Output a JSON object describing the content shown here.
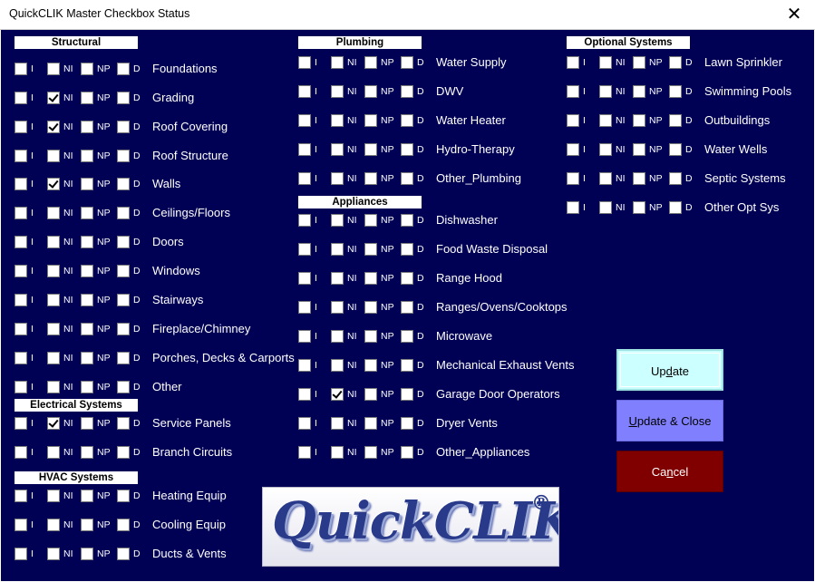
{
  "window": {
    "title": "QuickCLIK Master Checkbox Status",
    "close_glyph": "✕"
  },
  "checkbox_labels": [
    "I",
    "NI",
    "NP",
    "D"
  ],
  "sections": {
    "structural": {
      "header": "Structural",
      "items": [
        {
          "label": "Foundations",
          "checked": [
            false,
            false,
            false,
            false
          ]
        },
        {
          "label": "Grading",
          "checked": [
            false,
            true,
            false,
            false
          ]
        },
        {
          "label": "Roof Covering",
          "checked": [
            false,
            true,
            false,
            false
          ]
        },
        {
          "label": "Roof Structure",
          "checked": [
            false,
            false,
            false,
            false
          ]
        },
        {
          "label": "Walls",
          "checked": [
            false,
            true,
            false,
            false
          ]
        },
        {
          "label": "Ceilings/Floors",
          "checked": [
            false,
            false,
            false,
            false
          ]
        },
        {
          "label": "Doors",
          "checked": [
            false,
            false,
            false,
            false
          ]
        },
        {
          "label": "Windows",
          "checked": [
            false,
            false,
            false,
            false
          ]
        },
        {
          "label": "Stairways",
          "checked": [
            false,
            false,
            false,
            false
          ]
        },
        {
          "label": "Fireplace/Chimney",
          "checked": [
            false,
            false,
            false,
            false
          ]
        },
        {
          "label": "Porches, Decks & Carports",
          "checked": [
            false,
            false,
            false,
            false
          ]
        },
        {
          "label": "Other",
          "checked": [
            false,
            false,
            false,
            false
          ]
        }
      ]
    },
    "electrical": {
      "header": "Electrical Systems",
      "items": [
        {
          "label": "Service Panels",
          "checked": [
            false,
            true,
            false,
            false
          ]
        },
        {
          "label": "Branch Circuits",
          "checked": [
            false,
            false,
            false,
            false
          ]
        }
      ]
    },
    "hvac": {
      "header": "HVAC Systems",
      "items": [
        {
          "label": "Heating Equip",
          "checked": [
            false,
            false,
            false,
            false
          ]
        },
        {
          "label": "Cooling Equip",
          "checked": [
            false,
            false,
            false,
            false
          ]
        },
        {
          "label": "Ducts & Vents",
          "checked": [
            false,
            false,
            false,
            false
          ]
        }
      ]
    },
    "plumbing": {
      "header": "Plumbing",
      "items": [
        {
          "label": "Water Supply",
          "checked": [
            false,
            false,
            false,
            false
          ]
        },
        {
          "label": "DWV",
          "checked": [
            false,
            false,
            false,
            false
          ]
        },
        {
          "label": "Water Heater",
          "checked": [
            false,
            false,
            false,
            false
          ]
        },
        {
          "label": "Hydro-Therapy",
          "checked": [
            false,
            false,
            false,
            false
          ]
        },
        {
          "label": "Other_Plumbing",
          "checked": [
            false,
            false,
            false,
            false
          ]
        }
      ]
    },
    "appliances": {
      "header": "Appliances",
      "items": [
        {
          "label": "Dishwasher",
          "checked": [
            false,
            false,
            false,
            false
          ]
        },
        {
          "label": "Food Waste Disposal",
          "checked": [
            false,
            false,
            false,
            false
          ]
        },
        {
          "label": "Range Hood",
          "checked": [
            false,
            false,
            false,
            false
          ]
        },
        {
          "label": "Ranges/Ovens/Cooktops",
          "checked": [
            false,
            false,
            false,
            false
          ]
        },
        {
          "label": "Microwave",
          "checked": [
            false,
            false,
            false,
            false
          ]
        },
        {
          "label": "Mechanical Exhaust Vents",
          "checked": [
            false,
            false,
            false,
            false
          ]
        },
        {
          "label": "Garage Door Operators",
          "checked": [
            false,
            true,
            false,
            false
          ]
        },
        {
          "label": "Dryer Vents",
          "checked": [
            false,
            false,
            false,
            false
          ]
        },
        {
          "label": "Other_Appliances",
          "checked": [
            false,
            false,
            false,
            false
          ]
        }
      ]
    },
    "optional": {
      "header": "Optional Systems",
      "items": [
        {
          "label": "Lawn Sprinkler",
          "checked": [
            false,
            false,
            false,
            false
          ]
        },
        {
          "label": "Swimming Pools",
          "checked": [
            false,
            false,
            false,
            false
          ]
        },
        {
          "label": "Outbuildings",
          "checked": [
            false,
            false,
            false,
            false
          ]
        },
        {
          "label": "Water Wells",
          "checked": [
            false,
            false,
            false,
            false
          ]
        },
        {
          "label": "Septic Systems",
          "checked": [
            false,
            false,
            false,
            false
          ]
        },
        {
          "label": "Other Opt Sys",
          "checked": [
            false,
            false,
            false,
            false
          ]
        }
      ]
    }
  },
  "buttons": {
    "update": {
      "pre": "Up",
      "accel": "d",
      "post": "ate"
    },
    "update_close": {
      "pre": "",
      "accel": "U",
      "post": "pdate & Close"
    },
    "cancel": {
      "pre": "Ca",
      "accel": "n",
      "post": "cel"
    }
  },
  "logo": {
    "text": "QuickCLIK",
    "mark": "®"
  },
  "colors": {
    "background": "#000055",
    "update": "#ccffff",
    "update_close": "#8080ff",
    "cancel": "#800000"
  }
}
